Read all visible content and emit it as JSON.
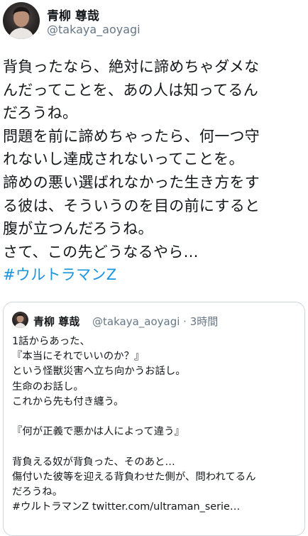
{
  "author": {
    "display_name": "青柳 尊哉",
    "handle": "@takaya_aoyagi"
  },
  "tweet": {
    "lines": [
      "背負ったなら、絶対に諦めちゃダメな",
      "んだってことを、あの人は知ってるん",
      "だろうね。",
      "問題を前に諦めちゃったら、何一つ守",
      "れないし達成されないってことを。",
      "諦めの悪い選ばれなかった生き方をす",
      "る彼は、そういうのを目の前にすると",
      "腹が立つんだろうね。",
      "さて、この先どうなるやら…"
    ],
    "hashtag": "#ウルトラマンZ"
  },
  "quoted_tweet": {
    "display_name": "青柳 尊哉",
    "meta": "@takaya_aoyagi · 3時間",
    "lines": [
      "1話からあった、",
      "『本当にそれでいいのか？』",
      "という怪獣災害へ立ち向かうお話し。",
      "生命のお話し。",
      "これから先も付き纏う。",
      "",
      "『何が正義で悪かは人によって違う』",
      "",
      "背負える奴が背負った、そのあと…",
      "傷付いた彼等を迎える背負わせた側が、問われてるん",
      "だろうね。",
      "#ウルトラマンZ twitter.com/ultraman_serie…"
    ]
  }
}
